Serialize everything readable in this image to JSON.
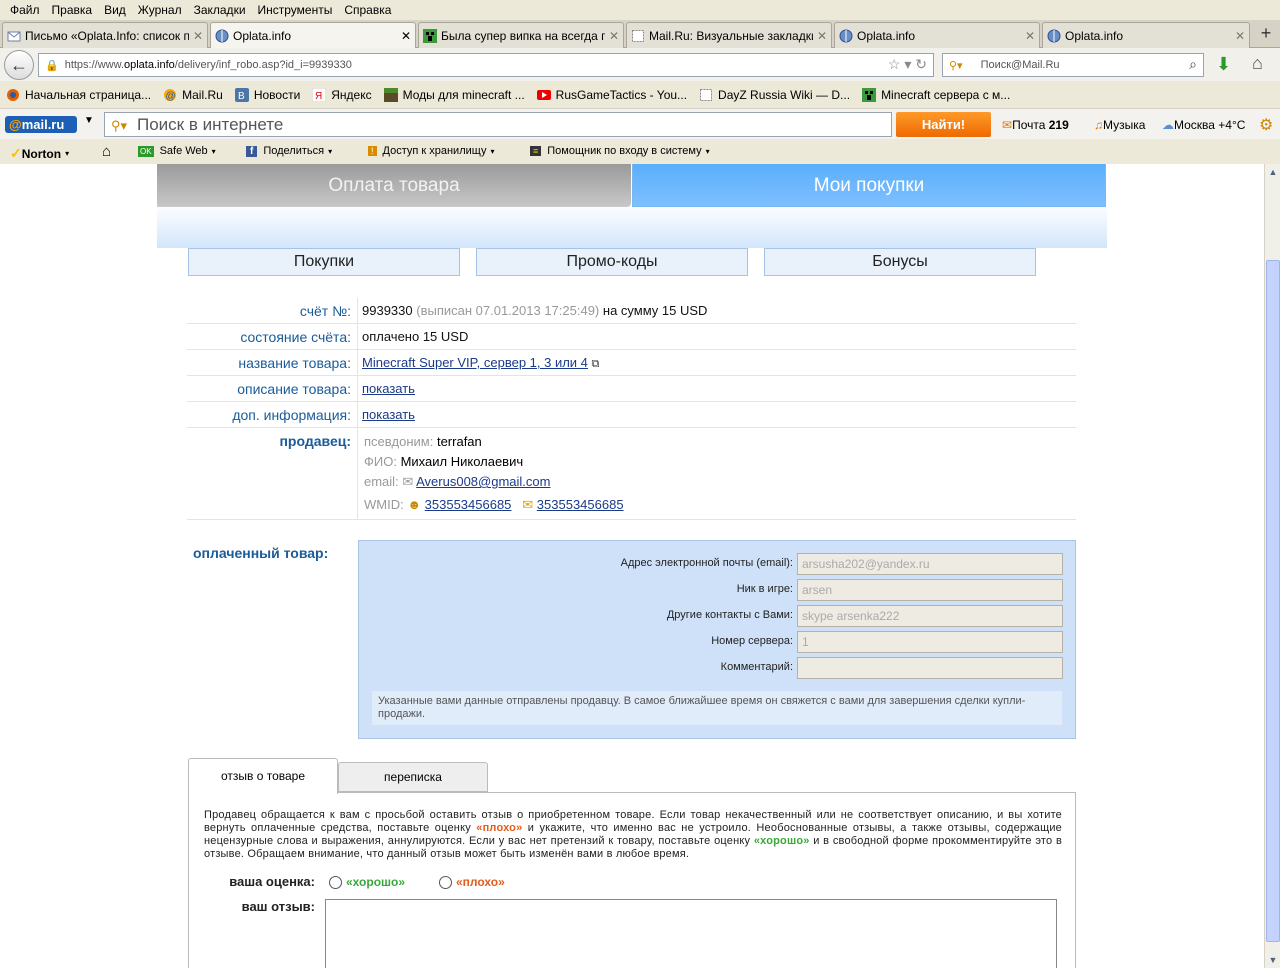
{
  "menu": [
    "Файл",
    "Правка",
    "Вид",
    "Журнал",
    "Закладки",
    "Инструменты",
    "Справка"
  ],
  "tabs": [
    {
      "label": "Письмо «Oplata.Info: список п...",
      "icon": "mail-icon"
    },
    {
      "label": "Oplata.info",
      "icon": "globe-icon",
      "active": true
    },
    {
      "label": "Была супер випка на всегда п...",
      "icon": "creeper-icon"
    },
    {
      "label": "Mail.Ru: Визуальные закладки",
      "icon": "page-icon"
    },
    {
      "label": "Oplata.info",
      "icon": "globe-icon"
    },
    {
      "label": "Oplata.info",
      "icon": "globe-icon"
    }
  ],
  "nav": {
    "url_prefix": "https://www.",
    "url_domain": "oplata.info",
    "url_rest": "/delivery/inf_robo.asp?id_i=9939330",
    "search_placeholder": "Поиск@Mail.Ru"
  },
  "bookmarks": [
    {
      "label": "Начальная страница...",
      "icon": "firefox-icon"
    },
    {
      "label": "Mail.Ru",
      "icon": "mailru-at-icon"
    },
    {
      "label": "Новости",
      "icon": "vk-icon"
    },
    {
      "label": "Яндекс",
      "icon": "yandex-icon"
    },
    {
      "label": "Моды для minecraft ...",
      "icon": "minecraft-icon"
    },
    {
      "label": "RusGameTactics - You...",
      "icon": "youtube-icon"
    },
    {
      "label": "DayZ Russia Wiki — D...",
      "icon": "page-icon"
    },
    {
      "label": "Minecraft сервера с м...",
      "icon": "creeper-icon"
    }
  ],
  "mailbar": {
    "logo_at": "@",
    "logo_text": "mail.ru",
    "search_placeholder": "Поиск в интернете",
    "find_button": "Найти!",
    "mail_label": "Почта",
    "mail_count": "219",
    "music": "Музыка",
    "weather": "Москва +4°C"
  },
  "nortonbar": {
    "norton": "Norton",
    "safeweb": "Safe Web",
    "share": "Поделиться",
    "storage": "Доступ к хранилищу",
    "helper": "Помощник по входу в систему"
  },
  "page": {
    "tab_pay": "Оплата товара",
    "tab_purchases": "Мои покупки",
    "subtabs": [
      "Покупки",
      "Промо-коды",
      "Бонусы"
    ],
    "invoice": {
      "label": "счёт №:",
      "number": "9939330",
      "issued": "(выписан 07.01.2013 17:25:49)",
      "sum_text": "на сумму 15 USD"
    },
    "status": {
      "label": "состояние счёта:",
      "value": "оплачено 15 USD"
    },
    "product_name": {
      "label": "название товара:",
      "value": "Minecraft Super VIP, сервер 1, 3 или 4"
    },
    "product_desc": {
      "label": "описание товара:",
      "value": "показать"
    },
    "extra_info": {
      "label": "доп. информация:",
      "value": "показать"
    },
    "seller": {
      "label": "продавец:",
      "nick_key": "псевдоним:",
      "nick": "terrafan",
      "fio_key": "ФИО:",
      "fio": "Михаил Николаевич",
      "email_key": "email:",
      "email": "Averus008@gmail.com",
      "wmid_key": "WMID:",
      "wmid1": "353553456685",
      "wmid2": "353553456685"
    },
    "paid_title": "оплаченный товар:",
    "form": [
      {
        "label": "Адрес электронной почты (email):",
        "value": "arsusha202@yandex.ru"
      },
      {
        "label": "Ник в игре:",
        "value": "arsen"
      },
      {
        "label": "Другие контакты с Вами:",
        "value": "skype arsenka222"
      },
      {
        "label": "Номер сервера:",
        "value": "1"
      },
      {
        "label": "Комментарий:",
        "value": ""
      }
    ],
    "notice": "Указанные вами данные отправлены продавцу. В самое ближайшее время он свяжется с вами для завершения сделки купли-продажи.",
    "review_tabs": [
      "отзыв о товаре",
      "переписка"
    ],
    "review": {
      "p1": "Продавец обращается к вам с просьбой оставить отзыв о приобретенном товаре. Если товар некачественный или не соответствует описанию, и вы хотите вернуть оплаченные средства, поставьте оценку ",
      "bad": "«плохо»",
      "p2": " и укажите, что именно вас не устроило. Необоснованные отзывы, а также отзывы, содержащие нецензурные слова и выражения, аннулируются. Если у вас нет претензий к товару, поставьте оценку ",
      "good": "«хорошо»",
      "p3": " и в свободной форме прокомментируйте это в отзыве. Обращаем внимание, что данный отзыв может быть изменён вами в любое время.",
      "rate_label": "ваша оценка:",
      "opt_good": "«хорошо»",
      "opt_bad": "«плохо»",
      "review_label": "ваш отзыв:"
    }
  }
}
